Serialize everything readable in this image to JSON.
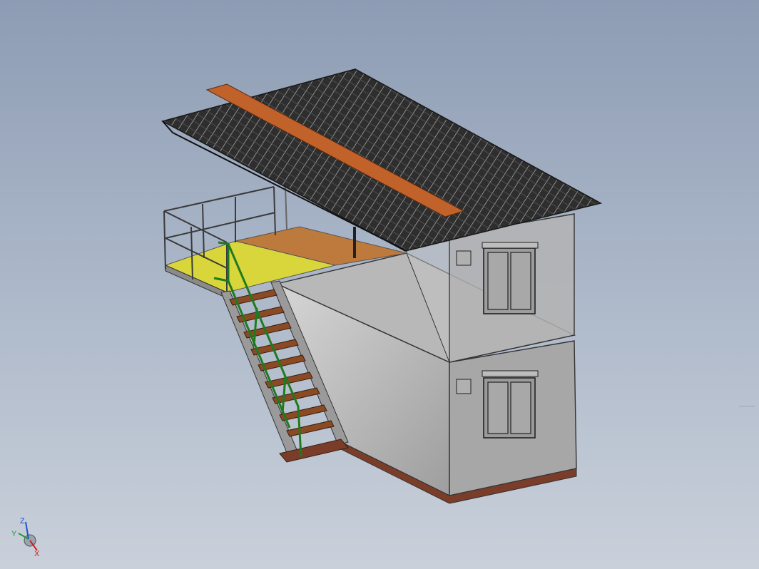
{
  "triad": {
    "z_label": "Z",
    "y_label": "Y",
    "x_label": "X"
  },
  "colors": {
    "roof_dark": "#2b2b2b",
    "roof_ridge": "#c0622a",
    "roof_trim": "#8a2f2f",
    "deck_yellow": "#d8d63a",
    "deck_orange": "#c0732e",
    "stair_green": "#1f7a1f",
    "stair_tread": "#8a4a24",
    "container_light": "#c8c8c8",
    "container_mid": "#a3a3a3",
    "frame_outline": "#3a3a3a"
  }
}
